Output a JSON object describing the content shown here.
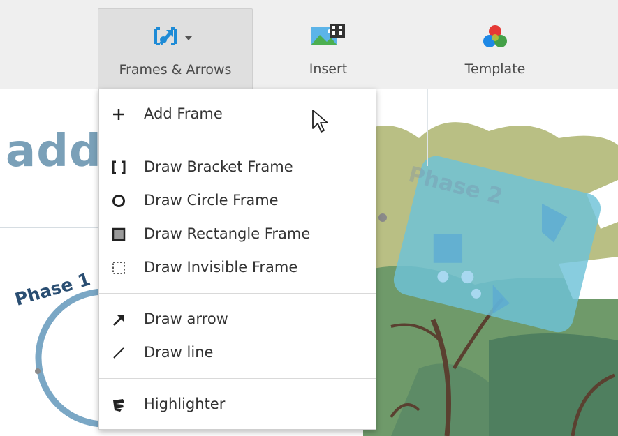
{
  "toolbar": {
    "items": [
      {
        "label": "Frames & Arrows",
        "icon": "frame-arrow-icon",
        "active": true
      },
      {
        "label": "Insert",
        "icon": "insert-media-icon"
      },
      {
        "label": "Template",
        "icon": "template-icon"
      }
    ]
  },
  "canvas": {
    "heading": "add",
    "phase1_title": "Phase 1",
    "phase2_title": "Phase 2"
  },
  "menu": {
    "items": [
      {
        "label": "Add Frame",
        "icon": "plus-icon"
      },
      {
        "label": "Draw Bracket Frame",
        "icon": "bracket-frame-icon"
      },
      {
        "label": "Draw Circle Frame",
        "icon": "circle-frame-icon"
      },
      {
        "label": "Draw Rectangle Frame",
        "icon": "rectangle-frame-icon"
      },
      {
        "label": "Draw Invisible Frame",
        "icon": "invisible-frame-icon"
      },
      {
        "label": "Draw arrow",
        "icon": "arrow-icon"
      },
      {
        "label": "Draw line",
        "icon": "line-icon"
      },
      {
        "label": "Highlighter",
        "icon": "highlighter-icon"
      }
    ]
  },
  "colors": {
    "accent_blue": "#1e8bd6",
    "heading_color": "#7aa0b8",
    "phase2_frame": "#6ec2d8"
  }
}
